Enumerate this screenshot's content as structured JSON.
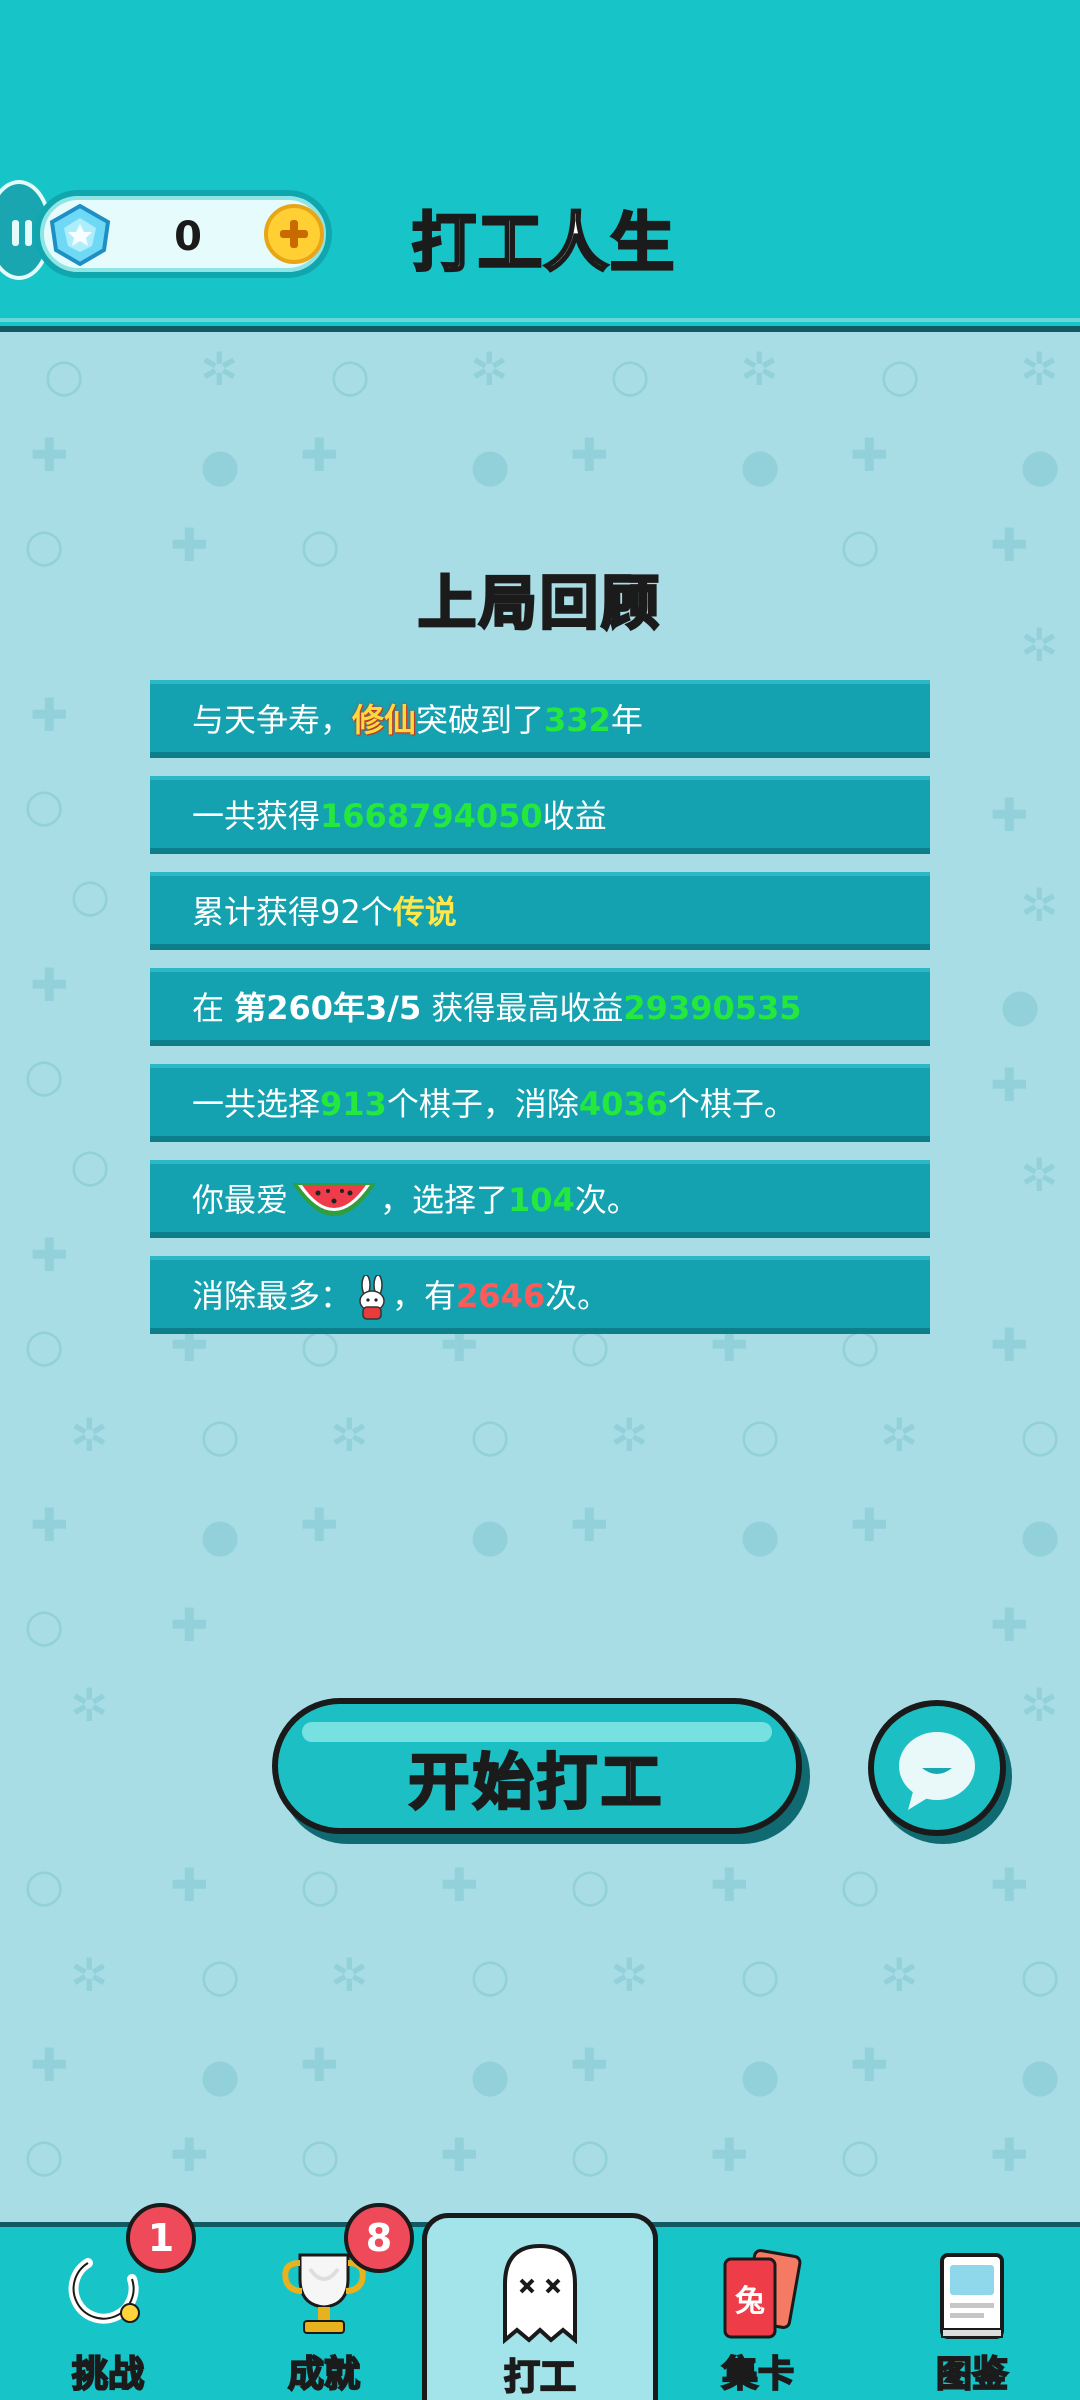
{
  "header": {
    "title": "打工人生",
    "gem_count": "0",
    "accent_color": "#17c4c7"
  },
  "review": {
    "title": "上局回顾",
    "rows": [
      {
        "parts": [
          "与天争寿，",
          "修仙",
          "突破到了",
          "332",
          "年"
        ]
      },
      {
        "parts": [
          "一共获得",
          "1668794050",
          "收益"
        ]
      },
      {
        "parts": [
          "累计获得92个",
          "传说"
        ]
      },
      {
        "parts": [
          "在 ",
          "第260年3/5",
          " 获得最高收益",
          "29390535"
        ]
      },
      {
        "parts": [
          "一共选择",
          "913",
          "个棋子，消除",
          "4036",
          "个棋子。"
        ]
      },
      {
        "parts": [
          "你最爱",
          "，选择了",
          "104",
          "次。"
        ]
      },
      {
        "parts": [
          "消除最多：",
          "，有",
          "2646",
          "次。"
        ]
      }
    ]
  },
  "actions": {
    "start_label": "开始打工",
    "chat_icon": "chat-bubble-icon"
  },
  "nav": {
    "items": [
      {
        "label": "挑战",
        "badge": "1",
        "icon": "challenge-ring-icon"
      },
      {
        "label": "成就",
        "badge": "8",
        "icon": "trophy-icon"
      },
      {
        "label": "打工",
        "badge": "",
        "icon": "ghost-icon",
        "active": true
      },
      {
        "label": "集卡",
        "badge": "",
        "icon": "rabbit-card-icon"
      },
      {
        "label": "图鉴",
        "badge": "",
        "icon": "book-icon"
      }
    ]
  }
}
